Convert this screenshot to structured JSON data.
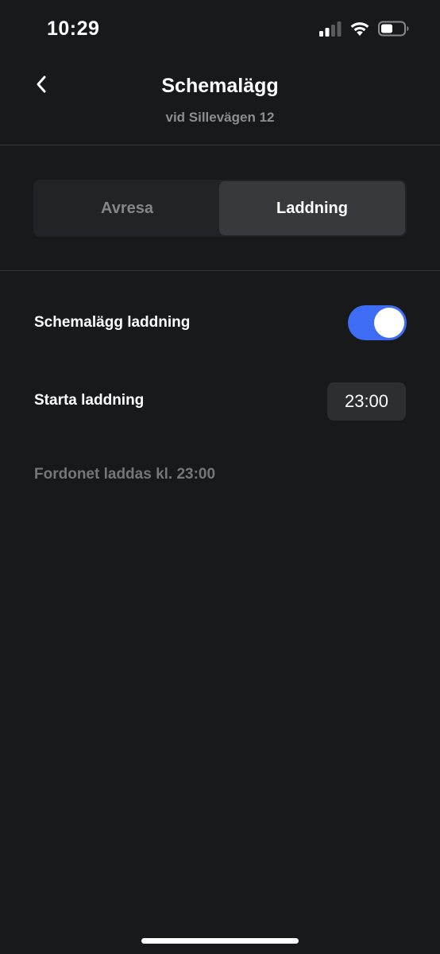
{
  "status_bar": {
    "time": "10:29",
    "icons": [
      "signal-icon",
      "wifi-icon",
      "battery-icon"
    ]
  },
  "header": {
    "back_icon": "chevron-left-icon",
    "title": "Schemalägg",
    "subtitle": "vid Sillevägen 12"
  },
  "tabs": [
    {
      "label": "Avresa",
      "selected": false
    },
    {
      "label": "Laddning",
      "selected": true
    }
  ],
  "settings": {
    "schedule_label": "Schemalägg laddning",
    "schedule_enabled": true,
    "start_label": "Starta laddning",
    "start_time": "23:00",
    "info": "Fordonet laddas kl. 23:00"
  },
  "colors": {
    "background": "#18191b",
    "accent": "#3e6cf4",
    "muted_text": "#85868a",
    "active_tab": "#38393d"
  }
}
